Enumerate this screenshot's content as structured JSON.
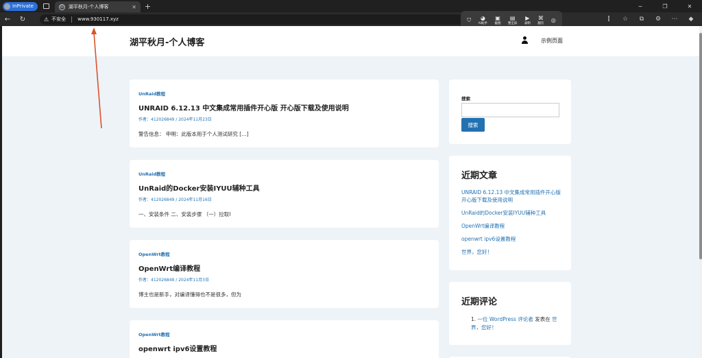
{
  "browser": {
    "mode_badge": "InPrivate",
    "tab_title": "湖平秋月-个人博客",
    "tab_close": "✕",
    "new_tab": "+",
    "security_text": "不安全",
    "url": "www.930117.xyz"
  },
  "mini_toolbar": [
    {
      "icon": "shield-icon",
      "glyph": "⛉",
      "label": ""
    },
    {
      "icon": "ai-assistant-icon",
      "glyph": "◕",
      "label": "AI助手"
    },
    {
      "icon": "screenshot-icon",
      "glyph": "▣",
      "label": "截图"
    },
    {
      "icon": "full-download-icon",
      "glyph": "▤",
      "label": "整全屏"
    },
    {
      "icon": "record-icon",
      "glyph": "▶",
      "label": "录制"
    },
    {
      "icon": "translate-icon",
      "glyph": "⌘",
      "label": "翻页"
    },
    {
      "icon": "target-icon",
      "glyph": "◎",
      "label": ""
    }
  ],
  "site": {
    "title": "湖平秋月-个人博客",
    "nav_sample_page": "示例页面"
  },
  "posts": [
    {
      "category": "UnRaid教程",
      "title": "UNRAID 6.12.13 中文集成常用插件开心版 开心版下载及使用说明",
      "author_label": "作者：",
      "author": "412026849",
      "date": "2024年11月23日",
      "excerpt": "警告信息： 申明：此版本用于个人测试研究 […]"
    },
    {
      "category": "UnRaid教程",
      "title": "UnRaid的Docker安装IYUU辅种工具",
      "author_label": "作者：",
      "author": "412026849",
      "date": "2024年11月16日",
      "excerpt": "一、安装条件 二、安装步骤 （一）拉取I"
    },
    {
      "category": "OpenWrt教程",
      "title": "OpenWrt编译教程",
      "author_label": "作者：",
      "author": "412026849",
      "date": "2024年11月3日",
      "excerpt": "博主也是新手，对编译懂得也不是很多，但为"
    },
    {
      "category": "OpenWrt教程",
      "title": "openwrt ipv6设置教程",
      "author_label": "",
      "author": "",
      "date": "",
      "excerpt": ""
    }
  ],
  "sidebar": {
    "search_label": "搜索",
    "search_button": "搜索",
    "recent_posts_title": "近期文章",
    "recent_posts": [
      "UNRAID 6.12.13 中文集成常用插件开心版 开心版下载及使用说明",
      "UnRaid的Docker安装IYUU辅种工具",
      "OpenWrt编译教程",
      "openwrt ipv6设置教程",
      "世界，您好！"
    ],
    "recent_comments_title": "近期评论",
    "comment": {
      "num": "1.",
      "author": "一位 WordPress 评论者",
      "mid": " 发表在 ",
      "post": "世界，您好！"
    }
  },
  "colors": {
    "accent": "#2271b1",
    "page_bg": "#eef3f8",
    "annotation_arrow": "#d9532b"
  }
}
